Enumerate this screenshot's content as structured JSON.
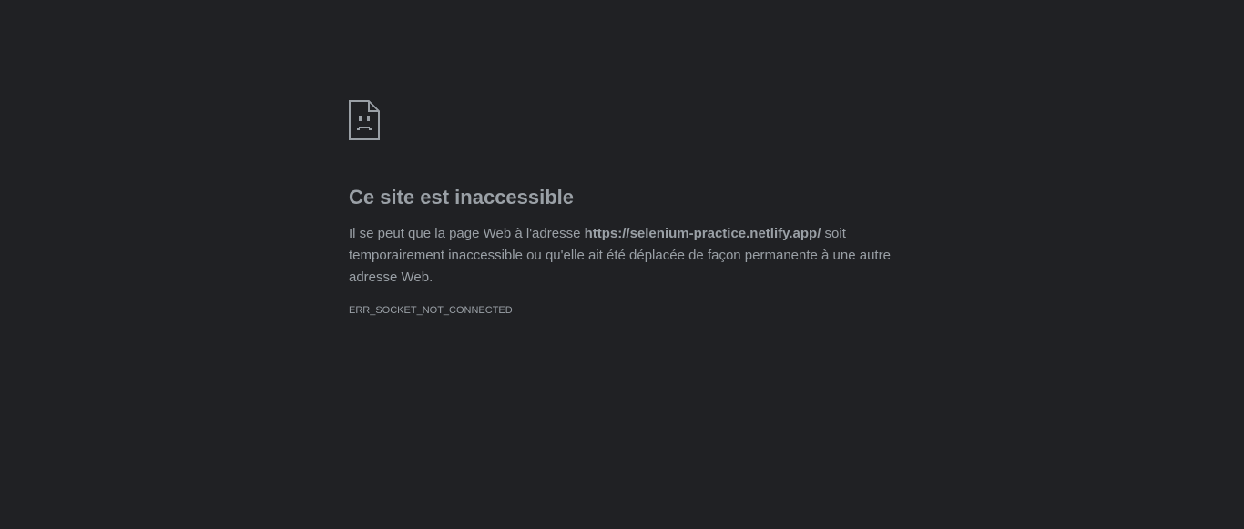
{
  "icon": "sad-page-icon",
  "title": "Ce site est inaccessible",
  "message": {
    "before": "Il se peut que la page Web à l'adresse ",
    "url": "https://selenium-practice.netlify.app/",
    "after": " soit temporairement inaccessible ou qu'elle ait été déplacée de façon permanente à une autre adresse Web."
  },
  "error_code": "ERR_SOCKET_NOT_CONNECTED",
  "colors": {
    "background": "#202124",
    "text": "#9aa0a6"
  }
}
